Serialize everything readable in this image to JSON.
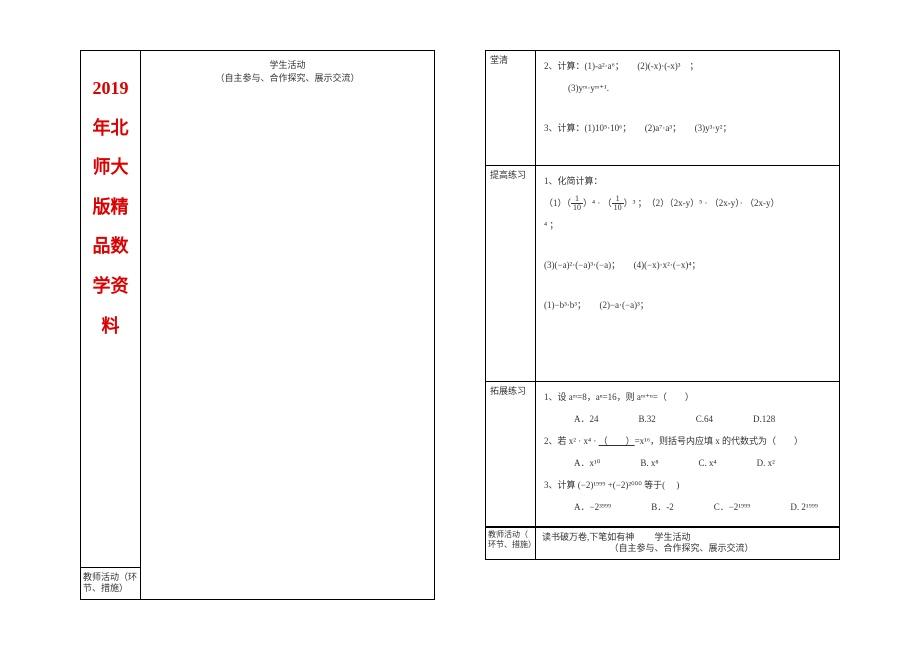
{
  "left": {
    "red_title": "2019年北师大版精品数学资料",
    "teacher_label": "教师活动（环节、措施）",
    "student_activity_l1": "学生活动",
    "student_activity_l2": "（自主参与、合作探究、展示交流）"
  },
  "right": {
    "rows": {
      "tangqing": {
        "label": "堂清",
        "q2": "2、计算：(1)-a²·a⁶；　　(2)(-x)·(-x)³　；",
        "q2b": "(3)yᵐ·yᵐ⁺¹.",
        "q3": "3、计算：(1)10⁵·10⁶；　　(2)a⁷·a³；　　(3)y³·y²；"
      },
      "tigao": {
        "label": "提高练习",
        "q1": "1、化简计算：",
        "q1a_pre": "（1）（",
        "q1a_mid1": "）⁴ · （",
        "q1a_mid2": "）³ ；　（2）（2x-y）⁵ · （2x-y）· （2x-y）",
        "q1a_end": "⁴ ；",
        "q3": "(3)(−a)²·(−a)³·(−a)；　　(4)(−x)·x²·(−x)⁴；",
        "q4": "(1)−b³·b³；　　(2)−a·(−a)³；"
      },
      "tuozhan": {
        "label": "拓展练习",
        "q1": "1、设 aᵐ=8，aⁿ=16，则 aᵐ⁺ⁿ=（　　）",
        "q1_opts": [
          "A．24",
          "B.32",
          "C.64",
          "D.128"
        ],
        "q2_pre": "2、若 x² · x⁴ · ",
        "q2_ul": "（　　）",
        "q2_post": "=x¹⁶，则括号内应填 x 的代数式为（　　）",
        "q2_opts": [
          "A．x¹⁰",
          "B. x⁸",
          "C. x⁴",
          "D. x²"
        ],
        "q3": "3、计算 (−2)¹⁹⁹⁹ +(−2)²⁰⁰⁰ 等于(　 )",
        "q3_opts": [
          "A．−2³⁹⁹⁹",
          "B．-2",
          "C．−2¹⁹⁹⁹",
          "D. 2¹⁹⁹⁹"
        ]
      },
      "footer": {
        "label": "教师活动（ 环节、措施）",
        "text1": "读书破万卷,下笔如有神",
        "text2": "学生活动",
        "text3": "（自主参与、合作探究、展示交流）"
      }
    }
  }
}
